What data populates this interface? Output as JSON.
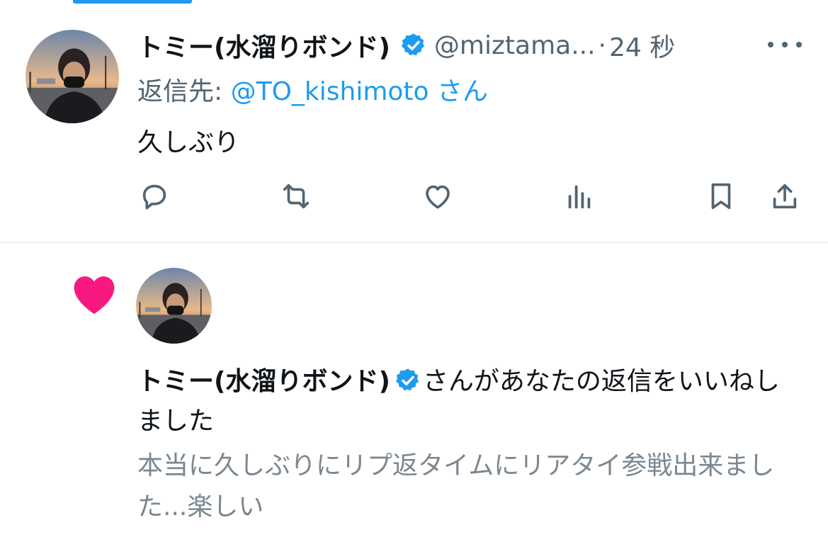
{
  "tweet": {
    "display_name": "トミー(水溜りボンド)",
    "verified_icon": "verified-badge-icon",
    "handle": "@miztama...",
    "separator": "·",
    "time": "24 秒",
    "reply_prefix": "返信先: ",
    "reply_to": "@TO_kishimoto",
    "reply_suffix": " さん",
    "text": "久しぶり",
    "actions": [
      "reply-icon",
      "retweet-icon",
      "like-icon",
      "views-icon",
      "bookmark-icon",
      "share-icon"
    ]
  },
  "notification": {
    "icon": "heart-icon",
    "user_display_name": "トミー(水溜りボンド)",
    "action_text": "さんがあなたの返信をいいねしました",
    "quoted_text": "本当に久しぶりにリプ返タイムにリアタイ参戦出来ました...楽しい"
  },
  "colors": {
    "accent": "#1d9bf0",
    "like": "#f91880",
    "text_primary": "#0f1419",
    "text_secondary": "#536471"
  }
}
